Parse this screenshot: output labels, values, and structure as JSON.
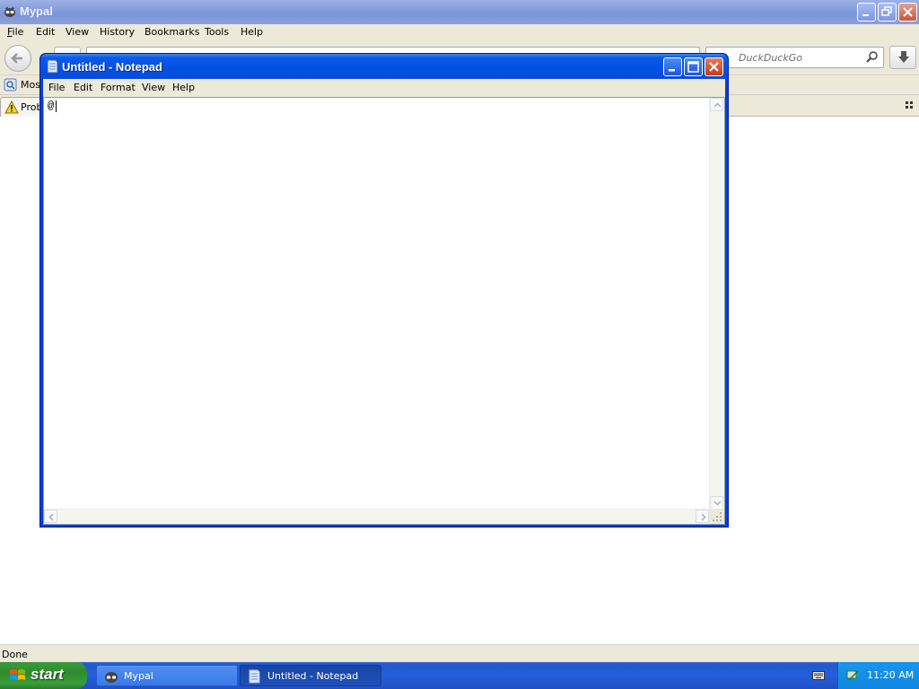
{
  "browser": {
    "title": "Mypal",
    "menu": [
      {
        "label": "File"
      },
      {
        "label": "Edit"
      },
      {
        "label": "View"
      },
      {
        "label": "History"
      },
      {
        "label": "Bookmarks"
      },
      {
        "label": "Tools"
      },
      {
        "label": "Help"
      }
    ],
    "search_placeholder": "DuckDuckGo",
    "bookmark_label": "Most",
    "tab_label": "Prob",
    "status": "Done"
  },
  "notepad": {
    "title": "Untitled - Notepad",
    "menu": [
      {
        "label": "File"
      },
      {
        "label": "Edit"
      },
      {
        "label": "Format"
      },
      {
        "label": "View"
      },
      {
        "label": "Help"
      }
    ],
    "content": "@"
  },
  "taskbar": {
    "start_label": "start",
    "tasks": [
      {
        "label": "Mypal",
        "icon": "mypal-icon",
        "active": false
      },
      {
        "label": "Untitled - Notepad",
        "icon": "notepad-icon",
        "active": true
      }
    ],
    "clock": "11:20 AM"
  },
  "colors": {
    "xp_blue": "#0a4bd9",
    "taskbar": "#245edb",
    "start_green": "#3a9d3a",
    "window_face": "#ece9d8"
  }
}
